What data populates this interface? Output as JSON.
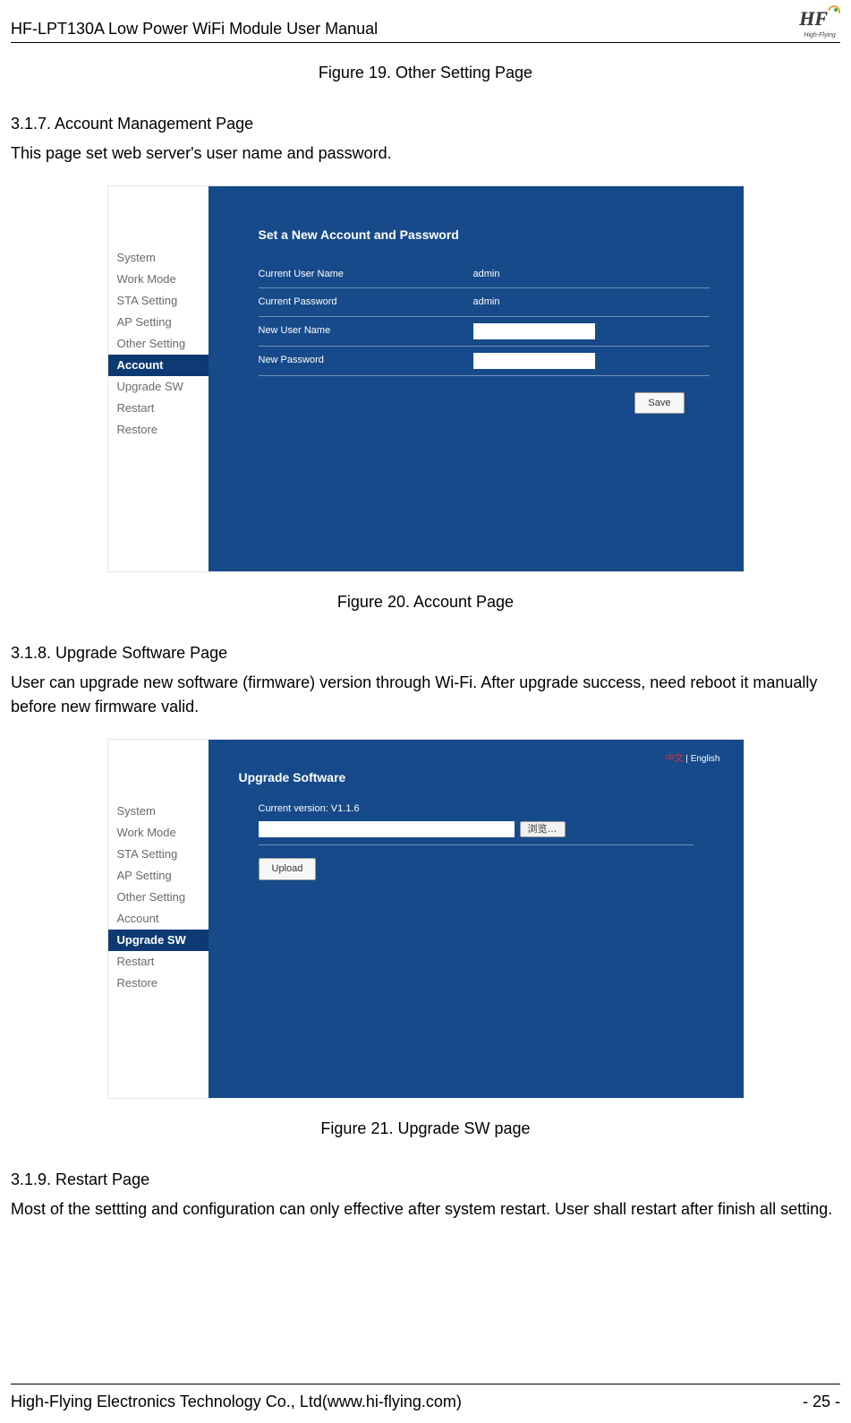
{
  "header": {
    "title": "HF-LPT130A Low Power WiFi Module User Manual",
    "logo_text": "HF",
    "logo_sub": "High-Flying"
  },
  "captions": {
    "fig19": "Figure 19.   Other Setting Page",
    "fig20": "Figure 20.   Account Page",
    "fig21": "Figure 21.   Upgrade SW page"
  },
  "sections": {
    "s317_head": "3.1.7.   Account Management Page",
    "s317_text": "This page set web server's user name and password.",
    "s318_head": "3.1.8.   Upgrade Software Page",
    "s318_text": "User can upgrade new software (firmware) version through Wi-Fi. After upgrade success, need reboot it manually before new firmware valid.",
    "s319_head": "3.1.9.   Restart Page",
    "s319_text": "Most of the settting and configuration can only effective after system restart. User shall restart after finish all setting."
  },
  "sidebar_items": [
    "System",
    "Work Mode",
    "STA Setting",
    "AP Setting",
    "Other Setting",
    "Account",
    "Upgrade SW",
    "Restart",
    "Restore"
  ],
  "account_panel": {
    "title": "Set a New Account and Password",
    "rows": {
      "curr_user_label": "Current User Name",
      "curr_user_value": "admin",
      "curr_pass_label": "Current Password",
      "curr_pass_value": "admin",
      "new_user_label": "New User Name",
      "new_pass_label": "New Password"
    },
    "save_label": "Save"
  },
  "upgrade_panel": {
    "lang_zh": "中文",
    "lang_sep": " | ",
    "lang_en": "English",
    "title": "Upgrade Software",
    "version_label": "Current version: V1.1.6",
    "browse_label": "浏览…",
    "upload_label": "Upload"
  },
  "footer": {
    "company": "High-Flying Electronics Technology Co., Ltd(www.hi-flying.com)",
    "page": "- 25 -"
  }
}
